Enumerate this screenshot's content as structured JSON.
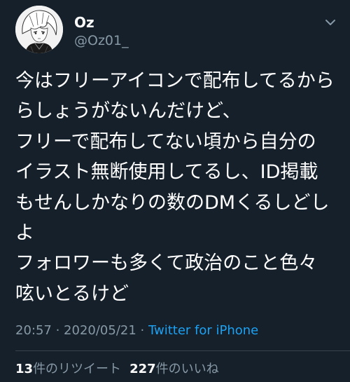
{
  "user": {
    "display_name": "Oz",
    "handle": "@Oz01_"
  },
  "tweet": {
    "text": "今はフリーアイコンで配布してるから\nらしょうがないんだけど、\nフリーで配布してない頃から自分の\nイラスト無断使用してるし、ID掲載\nもせんしかなりの数のDMくるしどし\nよ\nフォロワーも多くて政治のこと色々\n呟いとるけど",
    "time": "20:57",
    "date": "2020/05/21",
    "separator": " · ",
    "source": "Twitter for iPhone"
  },
  "stats": {
    "retweets_count": "13",
    "retweets_label": "件のリツイート",
    "likes_count": "227",
    "likes_label": "件のいいね"
  },
  "icons": {
    "avatar": "anime-avatar-icon",
    "more": "chevron-down-icon"
  },
  "colors": {
    "background": "#15202b",
    "secondary_text": "#8899a6",
    "link": "#1da1f2",
    "divider": "#38444d"
  }
}
